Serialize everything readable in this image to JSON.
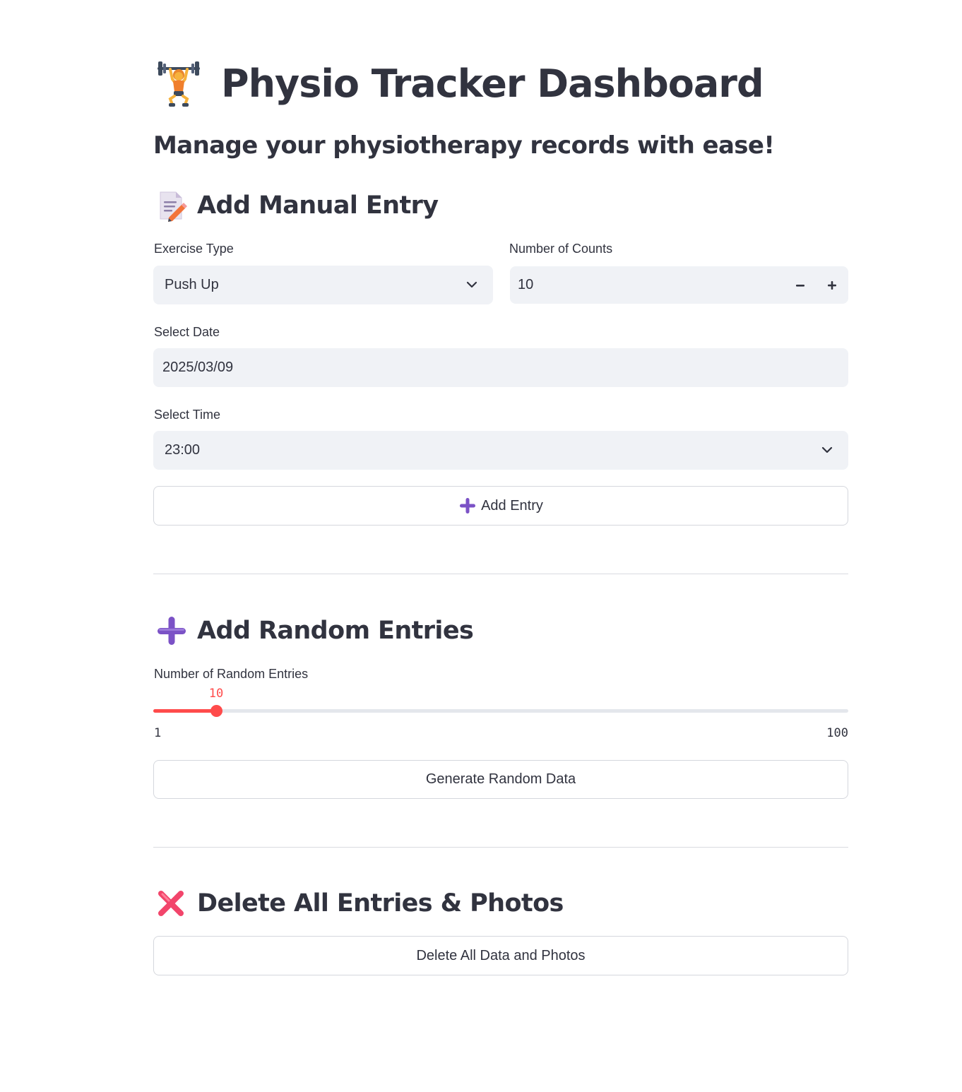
{
  "header": {
    "title": "Physio Tracker Dashboard",
    "title_icon": "weightlifter-icon",
    "subtitle": "Manage your physiotherapy records with ease!"
  },
  "manual_entry": {
    "heading": "Add Manual Entry",
    "heading_icon": "memo-icon",
    "exercise_type": {
      "label": "Exercise Type",
      "value": "Push Up"
    },
    "counts": {
      "label": "Number of Counts",
      "value": "10",
      "decrement": "−",
      "increment": "+"
    },
    "date": {
      "label": "Select Date",
      "value": "2025/03/09"
    },
    "time": {
      "label": "Select Time",
      "value": "23:00"
    },
    "add_button": {
      "label": "Add Entry",
      "icon": "plus-icon"
    }
  },
  "random_entries": {
    "heading": "Add Random Entries",
    "heading_icon": "plus-icon",
    "slider": {
      "label": "Number of Random Entries",
      "value": 10,
      "value_text": "10",
      "min": 1,
      "max": 100,
      "min_text": "1",
      "max_text": "100"
    },
    "generate_button": "Generate Random Data"
  },
  "delete_section": {
    "heading": "Delete All Entries & Photos",
    "heading_icon": "cross-mark-icon",
    "delete_button": "Delete All Data and Photos"
  },
  "colors": {
    "accent": "#ff4b4b",
    "text": "#31333f",
    "field_bg": "#f0f2f6",
    "plus_purple": "#7b52c6",
    "cross_pink": "#f2456b"
  }
}
